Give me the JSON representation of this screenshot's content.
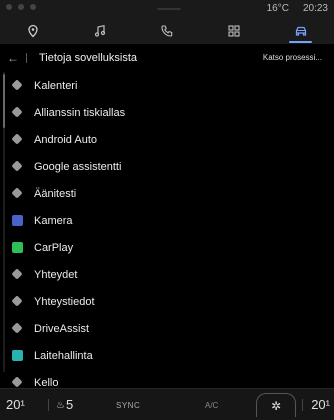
{
  "status": {
    "temperature": "16°C",
    "time": "20:23"
  },
  "nav": {
    "tabs": [
      {
        "icon": "navigation-pin-icon",
        "active": false
      },
      {
        "icon": "music-note-icon",
        "active": false
      },
      {
        "icon": "phone-icon",
        "active": false
      },
      {
        "icon": "apps-grid-icon",
        "active": false
      },
      {
        "icon": "car-icon",
        "active": true
      }
    ]
  },
  "header": {
    "title": "Tietoja sovelluksista",
    "action": "Katso prosessi..."
  },
  "apps": [
    {
      "label": "Kalenteri",
      "icon": "generic-app-icon"
    },
    {
      "label": "Allianssin tiskiallas",
      "icon": "generic-app-icon"
    },
    {
      "label": "Android Auto",
      "icon": "generic-app-icon"
    },
    {
      "label": "Google assistentti",
      "icon": "generic-app-icon"
    },
    {
      "label": "Äänitesti",
      "icon": "generic-app-icon"
    },
    {
      "label": "Kamera",
      "icon": "camera-app-icon",
      "color": "#4a63c8"
    },
    {
      "label": "CarPlay",
      "icon": "carplay-app-icon",
      "color": "#2fbf5a"
    },
    {
      "label": "Yhteydet",
      "icon": "generic-app-icon"
    },
    {
      "label": "Yhteystiedot",
      "icon": "generic-app-icon"
    },
    {
      "label": "DriveAssist",
      "icon": "generic-app-icon"
    },
    {
      "label": "Laitehallinta",
      "icon": "device-management-app-icon",
      "color": "#27b3b0"
    },
    {
      "label": "Kello",
      "icon": "generic-app-icon"
    }
  ],
  "climate": {
    "left_temp": "20",
    "seat_level": "5",
    "sync_label": "SYNC",
    "ac_label": "A/C",
    "right_temp": "20"
  },
  "colors": {
    "accent": "#7aa0ff",
    "background": "#000000"
  }
}
